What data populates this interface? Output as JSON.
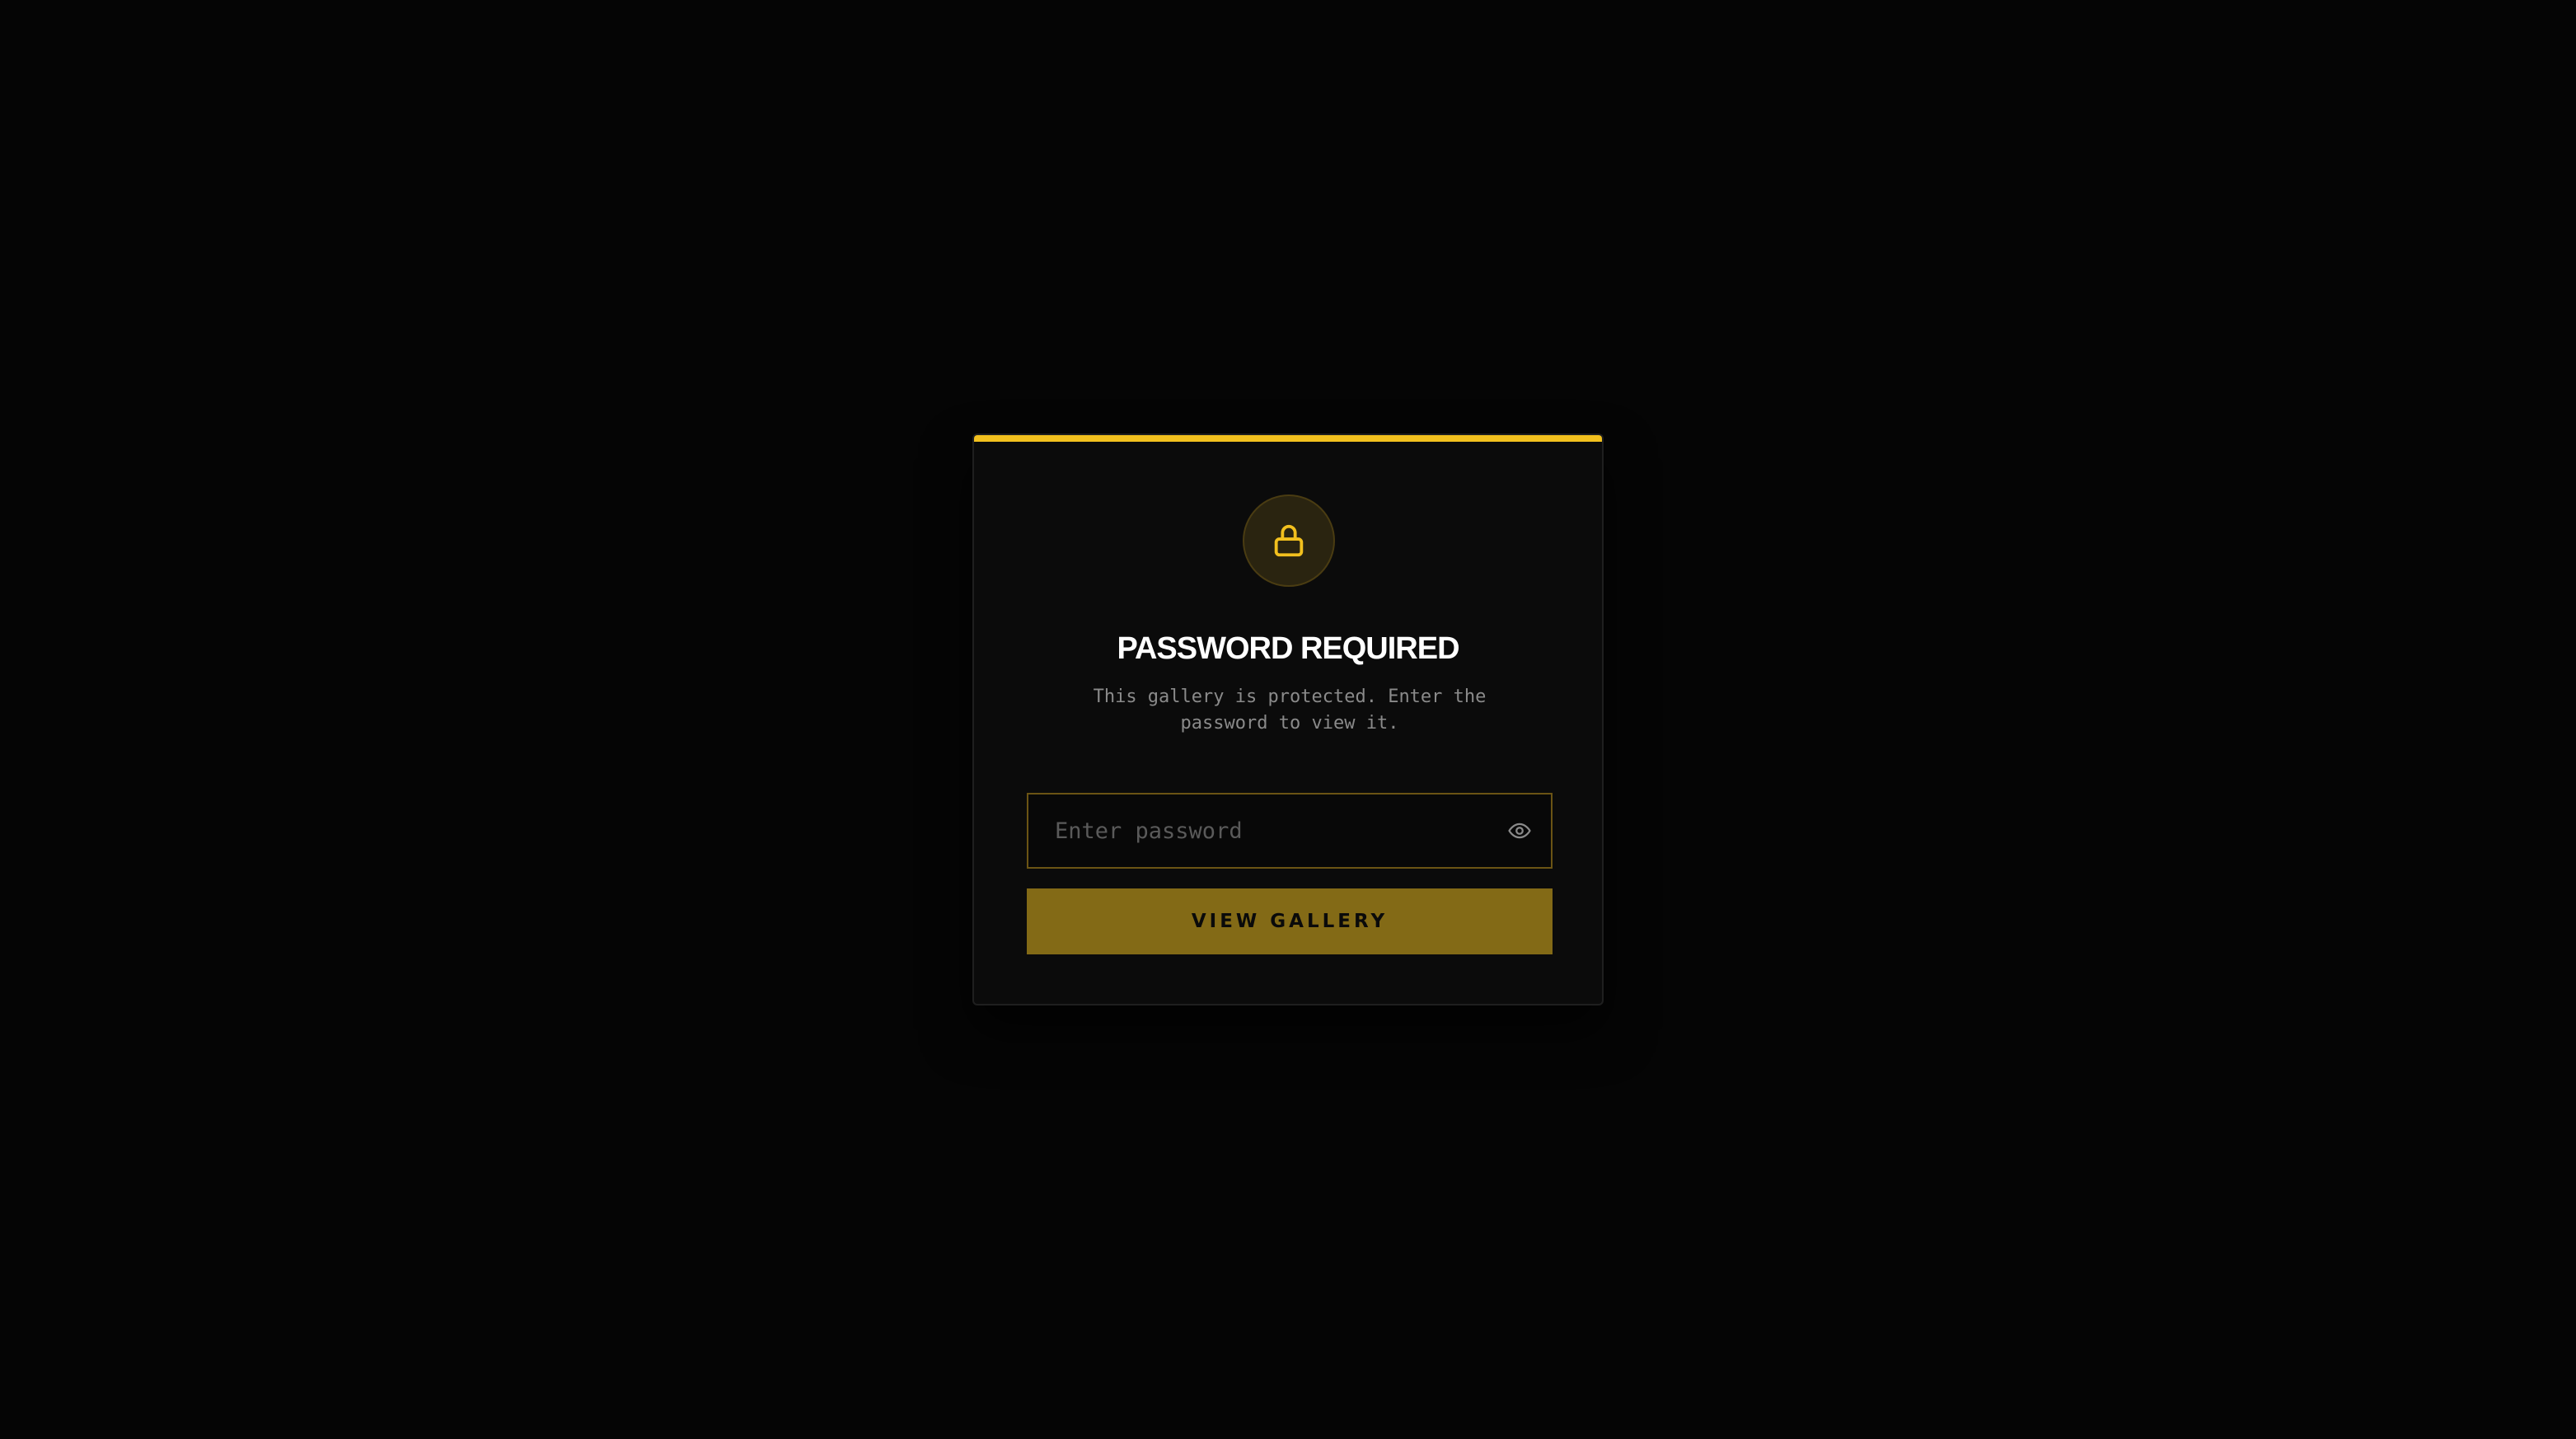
{
  "dialog": {
    "title": "PASSWORD REQUIRED",
    "description": "This gallery is protected. Enter the password to view it.",
    "icon": "lock-icon"
  },
  "password_field": {
    "value": "",
    "placeholder": "Enter password",
    "toggle_icon": "eye-icon"
  },
  "submit": {
    "label": "VIEW GALLERY"
  },
  "colors": {
    "background": "#050505",
    "card": "#0b0b0b",
    "accent": "#f2c01e",
    "button": "#836a16",
    "field_border": "#6b5414"
  }
}
